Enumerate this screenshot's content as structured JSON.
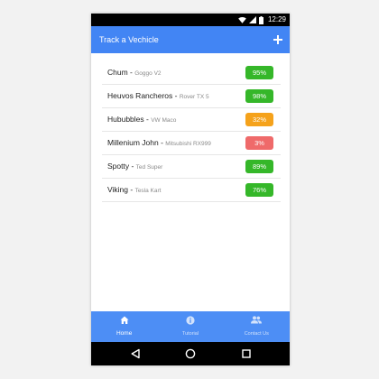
{
  "status_bar": {
    "time": "12:29",
    "icons": [
      "wifi-icon",
      "signal-icon",
      "battery-icon"
    ]
  },
  "app_bar": {
    "title": "Track a Vechicle",
    "action_icon": "plus-icon"
  },
  "vehicles": [
    {
      "name": "Chum",
      "separator": " - ",
      "vehicle": "Goggo V2",
      "percent": "95%",
      "status_color": "#35b729"
    },
    {
      "name": "Heuvos Rancheros",
      "separator": " - ",
      "vehicle": "Rover TX 5",
      "percent": "98%",
      "status_color": "#35b729"
    },
    {
      "name": "Hububbles",
      "separator": " - ",
      "vehicle": "VW Maco",
      "percent": "32%",
      "status_color": "#f5a21b"
    },
    {
      "name": "Millenium John",
      "separator": " - ",
      "vehicle": "Mitsubishi RX999",
      "percent": "3%",
      "status_color": "#ef6a6a"
    },
    {
      "name": "Spotty",
      "separator": " - ",
      "vehicle": "Ted Super",
      "percent": "89%",
      "status_color": "#35b729"
    },
    {
      "name": "Viking",
      "separator": " - ",
      "vehicle": "Tesla Kart",
      "percent": "76%",
      "status_color": "#35b729"
    }
  ],
  "bottom_nav": [
    {
      "label": "Home",
      "icon": "home-icon",
      "active": true
    },
    {
      "label": "Tutorial",
      "icon": "info-icon",
      "active": false
    },
    {
      "label": "Contact Us",
      "icon": "people-icon",
      "active": false
    }
  ],
  "system_nav": [
    "back-icon",
    "home-circle-icon",
    "recents-icon"
  ],
  "colors": {
    "app_bar": "#4285f4",
    "bottom_nav": "#4d8ef5",
    "status_bar": "#000000"
  }
}
